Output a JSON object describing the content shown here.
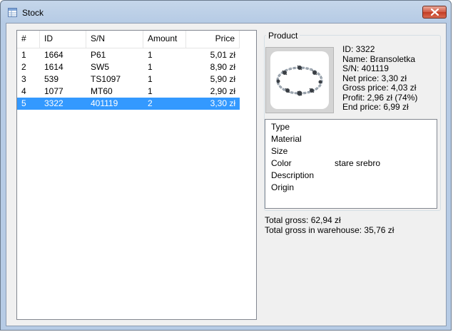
{
  "window": {
    "title": "Stock"
  },
  "list": {
    "columns": [
      "#",
      "ID",
      "S/N",
      "Amount",
      "Price"
    ],
    "rows": [
      {
        "num": "1",
        "id": "1664",
        "sn": "P61",
        "amount": "1",
        "price": "5,01 zł"
      },
      {
        "num": "2",
        "id": "1614",
        "sn": "SW5",
        "amount": "1",
        "price": "8,90 zł"
      },
      {
        "num": "3",
        "id": "539",
        "sn": "TS1097",
        "amount": "1",
        "price": "5,90 zł"
      },
      {
        "num": "4",
        "id": "1077",
        "sn": "MT60",
        "amount": "1",
        "price": "2,90 zł"
      },
      {
        "num": "5",
        "id": "3322",
        "sn": "401119",
        "amount": "2",
        "price": "3,30 zł"
      }
    ],
    "selected_index": 4
  },
  "product": {
    "group_label": "Product",
    "id_line": "ID: 3322",
    "name_line": "Name: Bransoletka",
    "sn_line": "S/N: 401119",
    "net_line": "Net price: 3,30 zł",
    "gross_line": "Gross price: 4,03 zł",
    "profit_line": "Profit: 2,96 zł (74%)",
    "end_line": "End price: 6,99 zł",
    "image_icon": "bracelet-photo"
  },
  "attributes": [
    {
      "label": "Type",
      "value": ""
    },
    {
      "label": "Material",
      "value": ""
    },
    {
      "label": "Size",
      "value": ""
    },
    {
      "label": "Color",
      "value": "stare srebro"
    },
    {
      "label": "Description",
      "value": ""
    },
    {
      "label": "Origin",
      "value": ""
    }
  ],
  "totals": {
    "gross": "Total gross: 62,94 zł",
    "warehouse": "Total gross in warehouse: 35,76 zł"
  },
  "colors": {
    "selection": "#3399ff",
    "close_button": "#c23c23"
  }
}
